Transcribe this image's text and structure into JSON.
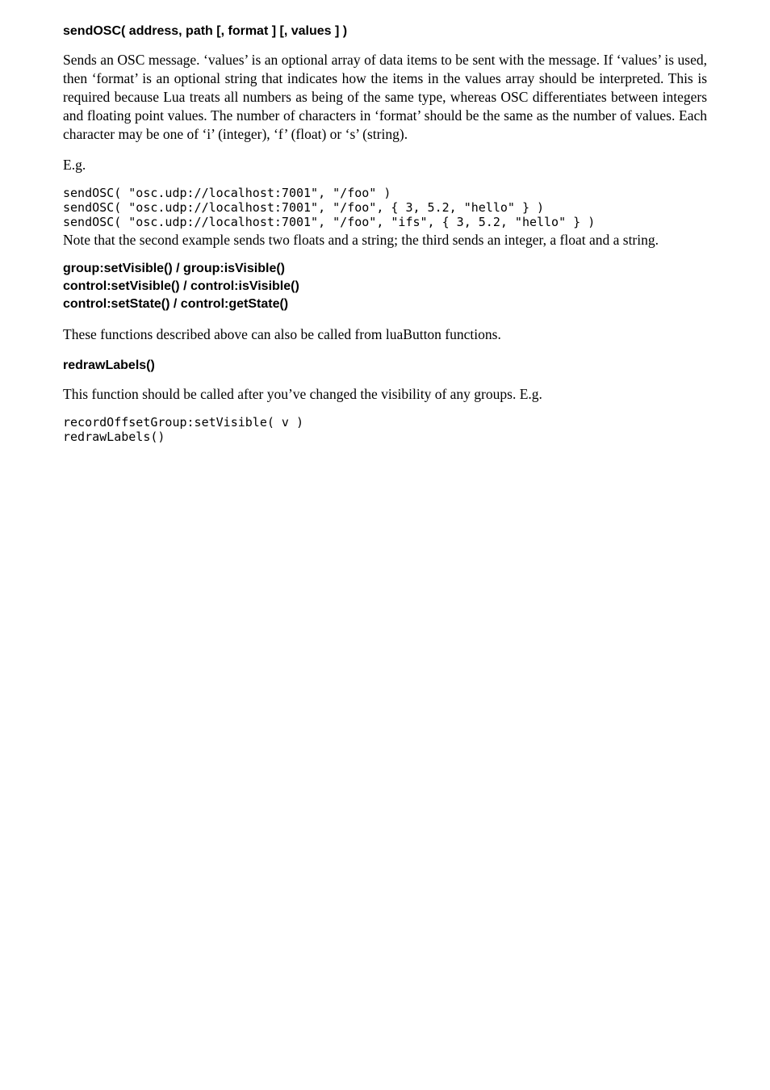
{
  "h1": "sendOSC( address, path [, format ] [, values ] )",
  "p1": "Sends an OSC message. ‘values’ is an optional array of data items to be sent with the message. If ‘values’ is used, then ‘format’ is an optional string that indicates how the items in the values array should be interpreted. This is required because Lua treats all numbers as being of the same type, whereas OSC differentiates between integers and floating point values. The number of characters in ‘format’ should be the same as the number of values. Each character may be one of ‘i’ (integer), ‘f’ (float) or ‘s’ (string).",
  "p2": "E.g.",
  "code1": "sendOSC( \"osc.udp://localhost:7001\", \"/foo\" )\nsendOSC( \"osc.udp://localhost:7001\", \"/foo\", { 3, 5.2, \"hello\" } )\nsendOSC( \"osc.udp://localhost:7001\", \"/foo\", \"ifs\", { 3, 5.2, \"hello\" } )",
  "p3": "Note that the second example sends two floats and a string; the third sends an integer, a float and a string.",
  "h2a": "group:setVisible() / group:isVisible()",
  "h2b": "control:setVisible() / control:isVisible()",
  "h2c": "control:setState() / control:getState()",
  "p4": "These functions described above can also be called from luaButton functions.",
  "h3": "redrawLabels()",
  "p5": "This function should be called after you’ve changed the visibility of any groups. E.g.",
  "code2": "recordOffsetGroup:setVisible( v )\nredrawLabels()"
}
